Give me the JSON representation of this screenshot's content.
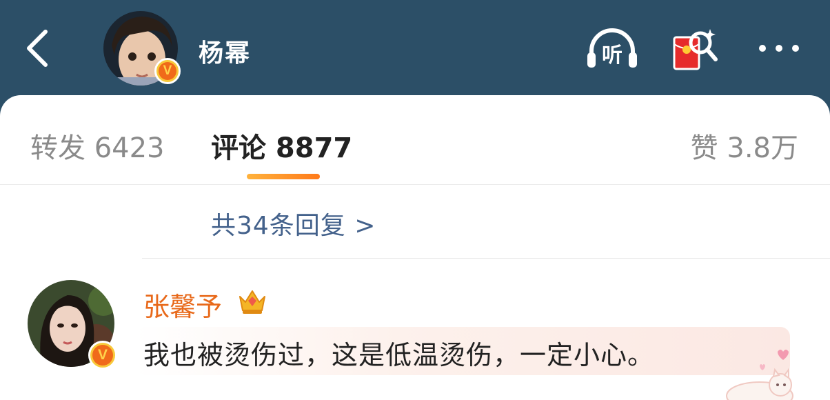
{
  "header": {
    "user_name": "杨幂",
    "listen_label": "听"
  },
  "tabs": {
    "repost": "转发 6423",
    "comment": "评论 8877",
    "like": "赞 3.8万"
  },
  "replies": {
    "more_label": "共34条回复 >"
  },
  "comment": {
    "author": "张馨予",
    "text": "我也被烫伤过，这是低温烫伤，一定小心。"
  },
  "colors": {
    "header_bg": "#2c4f67",
    "accent_orange": "#ff8a1f",
    "link_blue": "#43618b",
    "name_orange": "#e8691a"
  },
  "icons": [
    "back-icon",
    "listen-icon",
    "red-packet-search-icon",
    "more-icon",
    "crown-icon",
    "verified-badge-icon",
    "cat-sticker-icon"
  ]
}
